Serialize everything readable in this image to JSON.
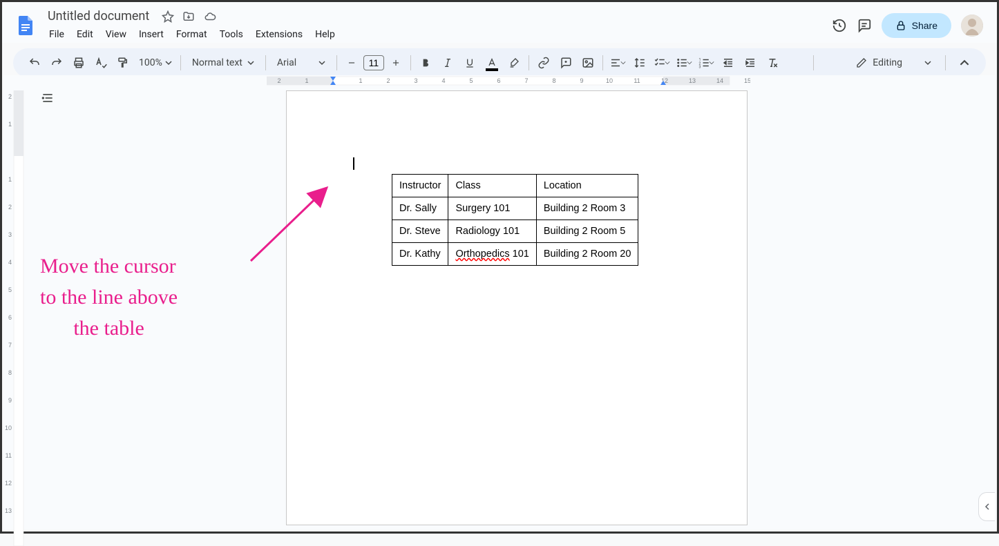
{
  "header": {
    "doc_title": "Untitled document",
    "menus": [
      "File",
      "Edit",
      "View",
      "Insert",
      "Format",
      "Tools",
      "Extensions",
      "Help"
    ],
    "share_label": "Share"
  },
  "toolbar": {
    "zoom": "100%",
    "paragraph_style": "Normal text",
    "font_family": "Arial",
    "font_size": "11",
    "editing_mode": "Editing"
  },
  "ruler": {
    "h_labels": [
      "2",
      "1",
      "1",
      "2",
      "3",
      "4",
      "5",
      "6",
      "7",
      "8",
      "9",
      "10",
      "11",
      "12",
      "13",
      "14",
      "15"
    ],
    "v_labels": [
      "2",
      "1",
      "1",
      "2",
      "3",
      "4",
      "5",
      "6",
      "7",
      "8",
      "9",
      "10",
      "11",
      "12",
      "13"
    ]
  },
  "document": {
    "table": {
      "headers": [
        "Instructor",
        "Class",
        "Location"
      ],
      "rows": [
        [
          "Dr. Sally",
          "Surgery 101",
          "Building 2 Room 3"
        ],
        [
          "Dr. Steve",
          "Radiology 101",
          "Building 2 Room 5"
        ],
        [
          "Dr. Kathy",
          "Orthopedics 101",
          "Building 2 Room 20"
        ]
      ],
      "spellcheck_word": "Orthopedics"
    }
  },
  "annotation": {
    "line1": "Move the cursor",
    "line2": "to the line above",
    "line3": "the table"
  }
}
